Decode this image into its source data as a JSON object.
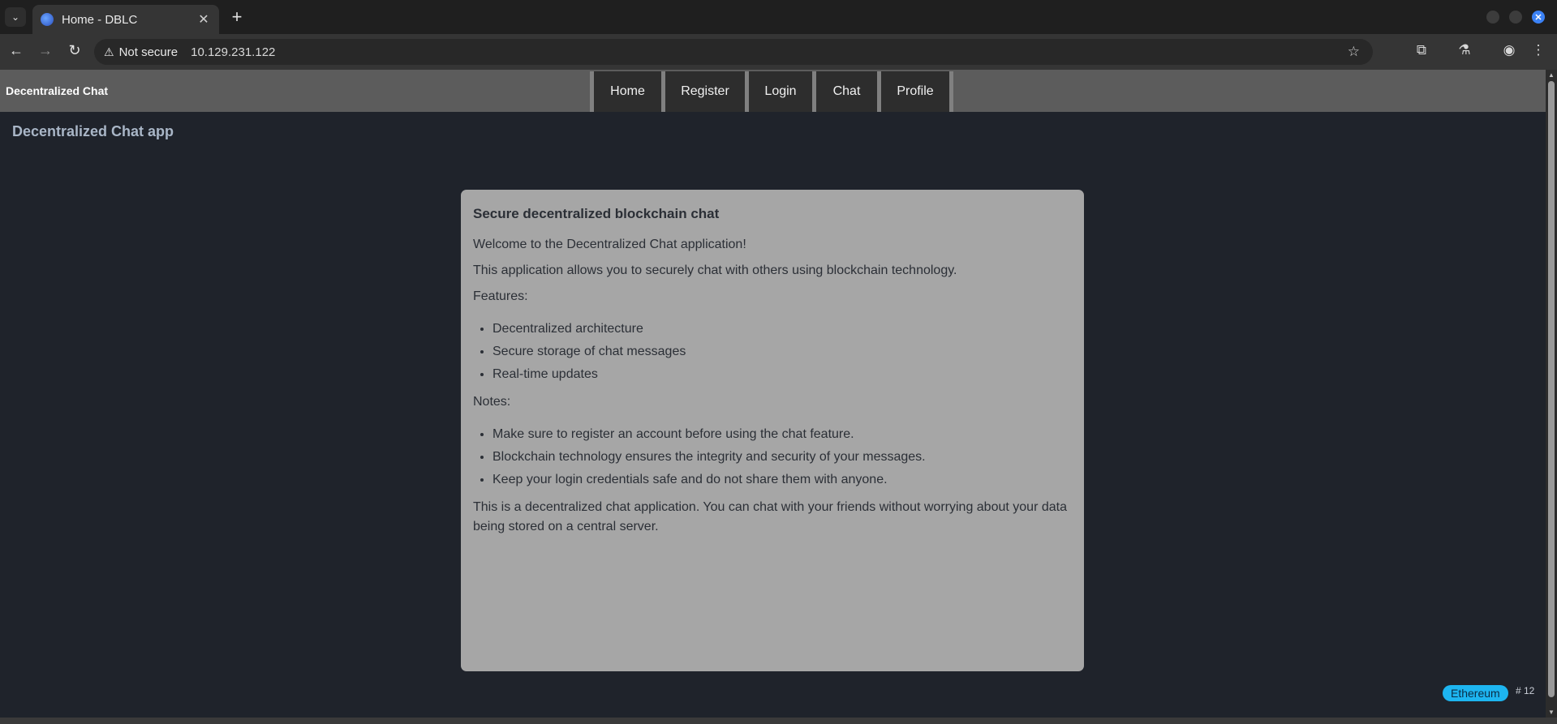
{
  "browser": {
    "tab": {
      "title": "Home - DBLC",
      "close_icon": "close-icon"
    },
    "security_label": "Not secure",
    "url": "10.129.231.122"
  },
  "site": {
    "brand": "Decentralized Chat",
    "nav": [
      {
        "label": "Home"
      },
      {
        "label": "Register"
      },
      {
        "label": "Login"
      },
      {
        "label": "Chat"
      },
      {
        "label": "Profile"
      }
    ],
    "page_title": "Decentralized Chat app"
  },
  "card": {
    "title": "Secure decentralized blockchain chat",
    "welcome": "Welcome to the Decentralized Chat application!",
    "intro": "This application allows you to securely chat with others using blockchain technology.",
    "features_heading": "Features:",
    "features": [
      "Decentralized architecture",
      "Secure storage of chat messages",
      "Real-time updates"
    ],
    "notes_heading": "Notes:",
    "notes": [
      "Make sure to register an account before using the chat feature.",
      "Blockchain technology ensures the integrity and security of your messages.",
      "Keep your login credentials safe and do not share them with anyone."
    ],
    "footer_text": "This is a decentralized chat application. You can chat with your friends without worrying about your data being stored on a central server."
  },
  "status": {
    "network": "Ethereum",
    "block": "# 12",
    "network_color": "#1db5f0"
  }
}
